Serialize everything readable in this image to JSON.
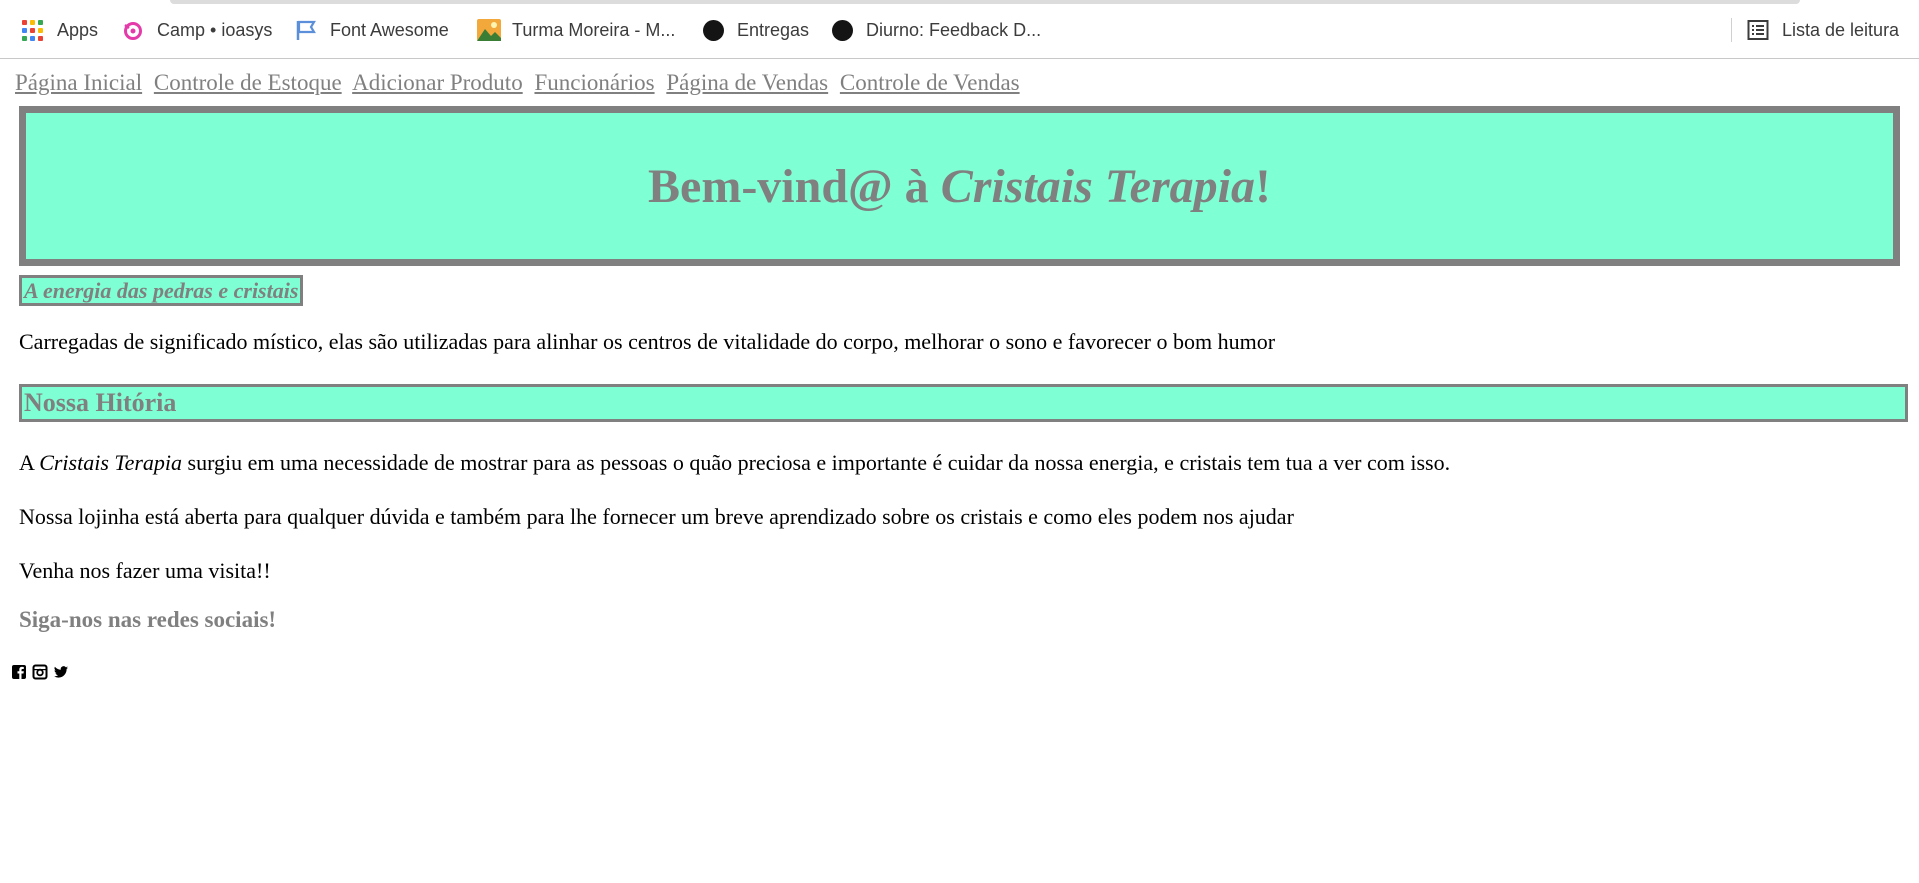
{
  "bookmarks": {
    "items": [
      {
        "label": "Apps",
        "icon": "apps-grid-icon"
      },
      {
        "label": "Camp • ioasys",
        "icon": "camp-icon"
      },
      {
        "label": "Font Awesome",
        "icon": "flag-icon"
      },
      {
        "label": "Turma Moreira - M...",
        "icon": "landscape-icon"
      },
      {
        "label": "Entregas",
        "icon": "black-circle-icon"
      },
      {
        "label": "Diurno: Feedback D...",
        "icon": "black-circle-icon"
      }
    ],
    "reading_list": "Lista de leitura"
  },
  "nav": [
    "Página Inicial",
    "Controle de Estoque",
    "Adicionar Produto",
    "Funcionários",
    "Página de Vendas",
    "Controle de Vendas"
  ],
  "hero": {
    "title_prefix": "Bem-vind@ à ",
    "title_brand": "Cristais Terapia",
    "title_suffix": "!"
  },
  "tagline": "A energia das pedras e cristais",
  "intro": "Carregadas de significado místico, elas são utilizadas para alinhar os centros de vitalidade do corpo, melhorar o sono e favorecer o bom humor",
  "history": {
    "title": "Nossa Hitória",
    "p1_prefix": "A ",
    "p1_brand": "Cristais Terapia",
    "p1_suffix": " surgiu em uma necessidade de mostrar para as pessoas o quão preciosa e importante é cuidar da nossa energia, e cristais tem tua a ver com isso.",
    "p2": "Nossa lojinha está aberta para qualquer dúvida e também para lhe fornecer um breve aprendizado sobre os cristais e como eles podem nos ajudar",
    "p3": "Venha nos fazer uma visita!!"
  },
  "follow": "Siga-nos nas redes sociais!",
  "socials": [
    "facebook-icon",
    "instagram-icon",
    "twitter-icon"
  ],
  "colors": {
    "accent": "#7fffd4",
    "gray": "#808080"
  }
}
